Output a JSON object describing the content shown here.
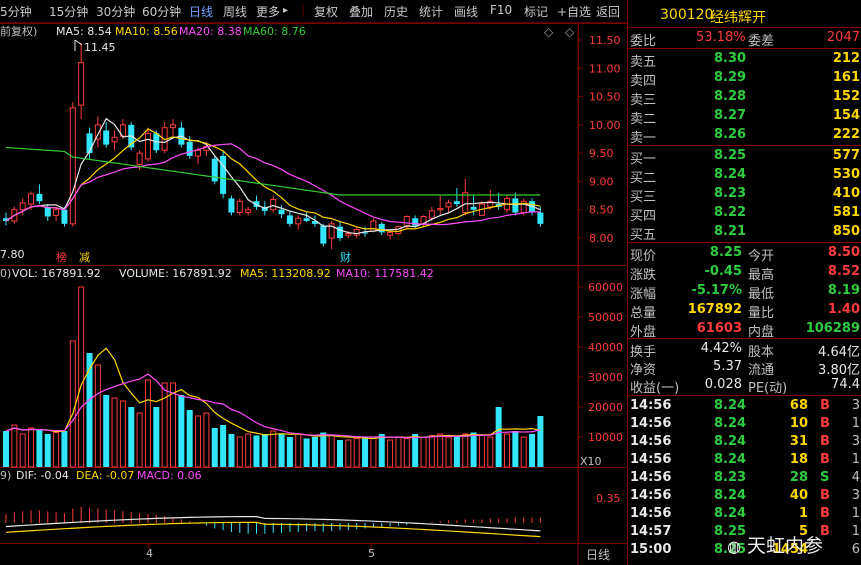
{
  "toolbar": {
    "periods": [
      "5分钟",
      "15分钟",
      "30分钟",
      "60分钟",
      "日线",
      "周线",
      "更多"
    ],
    "active_period": "日线",
    "more_arrow": "▸",
    "tools": [
      "复权",
      "叠加",
      "历史",
      "统计",
      "画线",
      "F10",
      "标记",
      "+自选",
      "返回"
    ]
  },
  "kline": {
    "label": "前复权)",
    "ma": [
      {
        "name": "MA5: 8.54",
        "color": "#e8e8e8"
      },
      {
        "name": "MA10: 8.56",
        "color": "#ffd700"
      },
      {
        "name": "MA20: 8.38",
        "color": "#ff4dff"
      },
      {
        "name": "MA60: 8.76",
        "color": "#33cc33"
      }
    ],
    "y_ticks": [
      "11.50",
      "11.00",
      "10.50",
      "10.00",
      "9.50",
      "9.00",
      "8.50",
      "8.00"
    ],
    "high_label": "11.45",
    "low_label": "7.80",
    "markers": [
      "榜",
      "减",
      "财"
    ],
    "diamond": "◇",
    "collapse": "◇"
  },
  "volume": {
    "label": "0)",
    "vol": "VOL: 167891.92",
    "volume": "VOLUME: 167891.92",
    "ma5": "MA5: 113208.92",
    "ma10": "MA10: 117581.42",
    "y_ticks": [
      "60000",
      "50000",
      "40000",
      "30000",
      "20000",
      "10000"
    ],
    "unit": "X10"
  },
  "macd": {
    "label": "9)",
    "dif": "DIF: -0.04",
    "dea": "DEA: -0.07",
    "macd": "MACD: 0.06",
    "y_tick": "0.35"
  },
  "x_axis": {
    "labels": [
      "4",
      "5"
    ],
    "period": "日线"
  },
  "colors": {
    "up": "#ff3b3b",
    "down": "#33e6ff",
    "ma5": "#e8e8e8",
    "ma10": "#ffd700",
    "ma20": "#ff4dff",
    "ma60": "#33cc33",
    "grid": "#7a0000"
  },
  "candles": [
    [
      8.35,
      8.45,
      8.22,
      8.3
    ],
    [
      8.3,
      8.55,
      8.25,
      8.5
    ],
    [
      8.5,
      8.7,
      8.4,
      8.62
    ],
    [
      8.6,
      8.82,
      8.5,
      8.78
    ],
    [
      8.78,
      8.95,
      8.6,
      8.65
    ],
    [
      8.55,
      8.6,
      8.3,
      8.38
    ],
    [
      8.4,
      8.55,
      8.3,
      8.5
    ],
    [
      8.5,
      8.55,
      8.2,
      8.25
    ],
    [
      8.25,
      10.4,
      8.2,
      10.3
    ],
    [
      10.35,
      11.45,
      10.1,
      11.1
    ],
    [
      9.85,
      9.95,
      9.4,
      9.5
    ],
    [
      9.75,
      10.15,
      9.6,
      10.0
    ],
    [
      9.9,
      10.05,
      9.6,
      9.65
    ],
    [
      9.7,
      9.9,
      9.55,
      9.78
    ],
    [
      9.8,
      10.1,
      9.75,
      10.0
    ],
    [
      10.0,
      10.05,
      9.55,
      9.6
    ],
    [
      9.3,
      9.55,
      9.2,
      9.5
    ],
    [
      9.4,
      9.95,
      9.35,
      9.85
    ],
    [
      9.85,
      9.9,
      9.5,
      9.55
    ],
    [
      9.55,
      10.05,
      9.5,
      9.95
    ],
    [
      9.95,
      10.1,
      9.8,
      10.0
    ],
    [
      9.95,
      10.05,
      9.6,
      9.65
    ],
    [
      9.7,
      9.8,
      9.4,
      9.45
    ],
    [
      9.45,
      9.6,
      9.3,
      9.55
    ],
    [
      9.55,
      9.7,
      9.45,
      9.62
    ],
    [
      9.4,
      9.45,
      8.95,
      9.0
    ],
    [
      9.45,
      9.55,
      8.7,
      8.78
    ],
    [
      8.7,
      8.75,
      8.4,
      8.45
    ],
    [
      8.45,
      8.7,
      8.4,
      8.65
    ],
    [
      8.45,
      8.55,
      8.4,
      8.5
    ],
    [
      8.65,
      8.75,
      8.5,
      8.55
    ],
    [
      8.55,
      8.65,
      8.4,
      8.48
    ],
    [
      8.5,
      8.75,
      8.45,
      8.68
    ],
    [
      8.5,
      8.58,
      8.35,
      8.42
    ],
    [
      8.4,
      8.48,
      8.2,
      8.25
    ],
    [
      8.25,
      8.4,
      8.15,
      8.35
    ],
    [
      8.35,
      8.45,
      8.28,
      8.3
    ],
    [
      8.3,
      8.4,
      8.2,
      8.25
    ],
    [
      8.22,
      8.25,
      7.85,
      7.9
    ],
    [
      8.0,
      8.3,
      7.8,
      8.25
    ],
    [
      8.2,
      8.28,
      7.95,
      8.0
    ],
    [
      8.05,
      8.12,
      8.0,
      8.08
    ],
    [
      8.05,
      8.18,
      8.0,
      8.15
    ],
    [
      8.1,
      8.2,
      8.02,
      8.08
    ],
    [
      8.12,
      8.35,
      8.1,
      8.3
    ],
    [
      8.25,
      8.28,
      8.05,
      8.1
    ],
    [
      8.05,
      8.12,
      7.98,
      8.1
    ],
    [
      8.08,
      8.22,
      8.05,
      8.2
    ],
    [
      8.2,
      8.4,
      8.15,
      8.38
    ],
    [
      8.35,
      8.4,
      8.18,
      8.22
    ],
    [
      8.25,
      8.4,
      8.2,
      8.38
    ],
    [
      8.35,
      8.55,
      8.3,
      8.48
    ],
    [
      8.5,
      8.75,
      8.4,
      8.52
    ],
    [
      8.55,
      8.68,
      8.45,
      8.62
    ],
    [
      8.65,
      8.88,
      8.55,
      8.6
    ],
    [
      8.45,
      9.05,
      8.4,
      8.8
    ],
    [
      8.55,
      8.75,
      8.4,
      8.5
    ],
    [
      8.4,
      8.65,
      8.4,
      8.6
    ],
    [
      8.55,
      8.85,
      8.5,
      8.65
    ],
    [
      8.6,
      8.8,
      8.5,
      8.55
    ],
    [
      8.5,
      8.75,
      8.45,
      8.7
    ],
    [
      8.7,
      8.8,
      8.4,
      8.45
    ],
    [
      8.45,
      8.7,
      8.4,
      8.65
    ],
    [
      8.65,
      8.7,
      8.4,
      8.45
    ],
    [
      8.45,
      8.55,
      8.2,
      8.25
    ]
  ],
  "volumes": [
    12000,
    14000,
    11000,
    13000,
    12500,
    11000,
    11500,
    12000,
    42000,
    60000,
    38000,
    34000,
    24000,
    23000,
    22000,
    20000,
    18000,
    29000,
    20000,
    28000,
    28000,
    24000,
    19000,
    17000,
    18000,
    13000,
    14000,
    11000,
    10000,
    11000,
    10500,
    11000,
    12000,
    11000,
    10000,
    11000,
    9500,
    10000,
    11500,
    10500,
    9000,
    9000,
    9500,
    10000,
    10000,
    11000,
    9000,
    10000,
    9500,
    11000,
    10000,
    10500,
    11000,
    10000,
    10500,
    11000,
    11500,
    10500,
    10000,
    20000,
    11000,
    12000,
    10000,
    11000,
    17000
  ],
  "macd_bars": [
    0.1,
    0.12,
    0.13,
    0.14,
    0.14,
    0.13,
    0.12,
    0.11,
    0.16,
    0.18,
    0.17,
    0.16,
    0.15,
    0.14,
    0.13,
    0.12,
    0.11,
    0.1,
    0.09,
    0.08,
    0.06,
    0.04,
    0.02,
    0.0,
    -0.03,
    -0.06,
    -0.08,
    -0.1,
    -0.11,
    -0.12,
    -0.12,
    -0.12,
    -0.11,
    -0.11,
    -0.1,
    -0.1,
    -0.09,
    -0.09,
    -0.1,
    -0.09,
    -0.08,
    -0.08,
    -0.07,
    -0.06,
    -0.05,
    -0.05,
    -0.04,
    -0.03,
    -0.02,
    -0.01,
    0.0,
    0.01,
    0.02,
    0.03,
    0.03,
    0.04,
    0.04,
    0.04,
    0.05,
    0.05,
    0.05,
    0.06,
    0.06,
    0.06,
    0.06
  ],
  "panel": {
    "code": "300120",
    "name": "经纬辉开",
    "ratio_label": "委比",
    "ratio_value": "53.18%",
    "diff_label": "委差",
    "diff_value": "2047",
    "asks": [
      {
        "label": "卖五",
        "price": "8.30",
        "vol": "212"
      },
      {
        "label": "卖四",
        "price": "8.29",
        "vol": "161"
      },
      {
        "label": "卖三",
        "price": "8.28",
        "vol": "152"
      },
      {
        "label": "卖二",
        "price": "8.27",
        "vol": "154"
      },
      {
        "label": "卖一",
        "price": "8.26",
        "vol": "222"
      }
    ],
    "bids": [
      {
        "label": "买一",
        "price": "8.25",
        "vol": "577"
      },
      {
        "label": "买二",
        "price": "8.24",
        "vol": "530"
      },
      {
        "label": "买三",
        "price": "8.23",
        "vol": "410"
      },
      {
        "label": "买四",
        "price": "8.22",
        "vol": "581"
      },
      {
        "label": "买五",
        "price": "8.21",
        "vol": "850"
      }
    ],
    "stats": [
      {
        "l1": "现价",
        "v1": "8.25",
        "c1": "green",
        "l2": "今开",
        "v2": "8.50",
        "c2": "red"
      },
      {
        "l1": "涨跌",
        "v1": "-0.45",
        "c1": "green",
        "l2": "最高",
        "v2": "8.52",
        "c2": "red"
      },
      {
        "l1": "涨幅",
        "v1": "-5.17%",
        "c1": "green",
        "l2": "最低",
        "v2": "8.19",
        "c2": "green"
      },
      {
        "l1": "总量",
        "v1": "167892",
        "c1": "yellow",
        "l2": "量比",
        "v2": "1.40",
        "c2": "red"
      },
      {
        "l1": "外盘",
        "v1": "61603",
        "c1": "red",
        "l2": "内盘",
        "v2": "106289",
        "c2": "green"
      }
    ],
    "info": [
      {
        "l1": "换手",
        "v1": "4.42%",
        "l2": "股本",
        "v2": "4.64亿"
      },
      {
        "l1": "净资",
        "v1": "5.37",
        "l2": "流通",
        "v2": "3.80亿"
      },
      {
        "l1": "收益(一)",
        "v1": "0.028",
        "l2": "PE(动)",
        "v2": "74.4"
      }
    ],
    "ticks": [
      {
        "time": "14:56",
        "price": "8.24",
        "vol": "68",
        "flag": "B",
        "n": "3"
      },
      {
        "time": "14:56",
        "price": "8.24",
        "vol": "10",
        "flag": "B",
        "n": "1"
      },
      {
        "time": "14:56",
        "price": "8.24",
        "vol": "31",
        "flag": "B",
        "n": "3"
      },
      {
        "time": "14:56",
        "price": "8.24",
        "vol": "18",
        "flag": "B",
        "n": "1"
      },
      {
        "time": "14:56",
        "price": "8.23",
        "vol": "28",
        "flag": "S",
        "n": "4"
      },
      {
        "time": "14:56",
        "price": "8.24",
        "vol": "40",
        "flag": "B",
        "n": "3"
      },
      {
        "time": "14:56",
        "price": "8.24",
        "vol": "1",
        "flag": "B",
        "n": "1"
      },
      {
        "time": "14:57",
        "price": "8.25",
        "vol": "5",
        "flag": "B",
        "n": "1"
      },
      {
        "time": "15:00",
        "price": "8.25",
        "vol": "1454",
        "flag": "",
        "n": "6"
      }
    ]
  },
  "watermark": "天虹内参"
}
